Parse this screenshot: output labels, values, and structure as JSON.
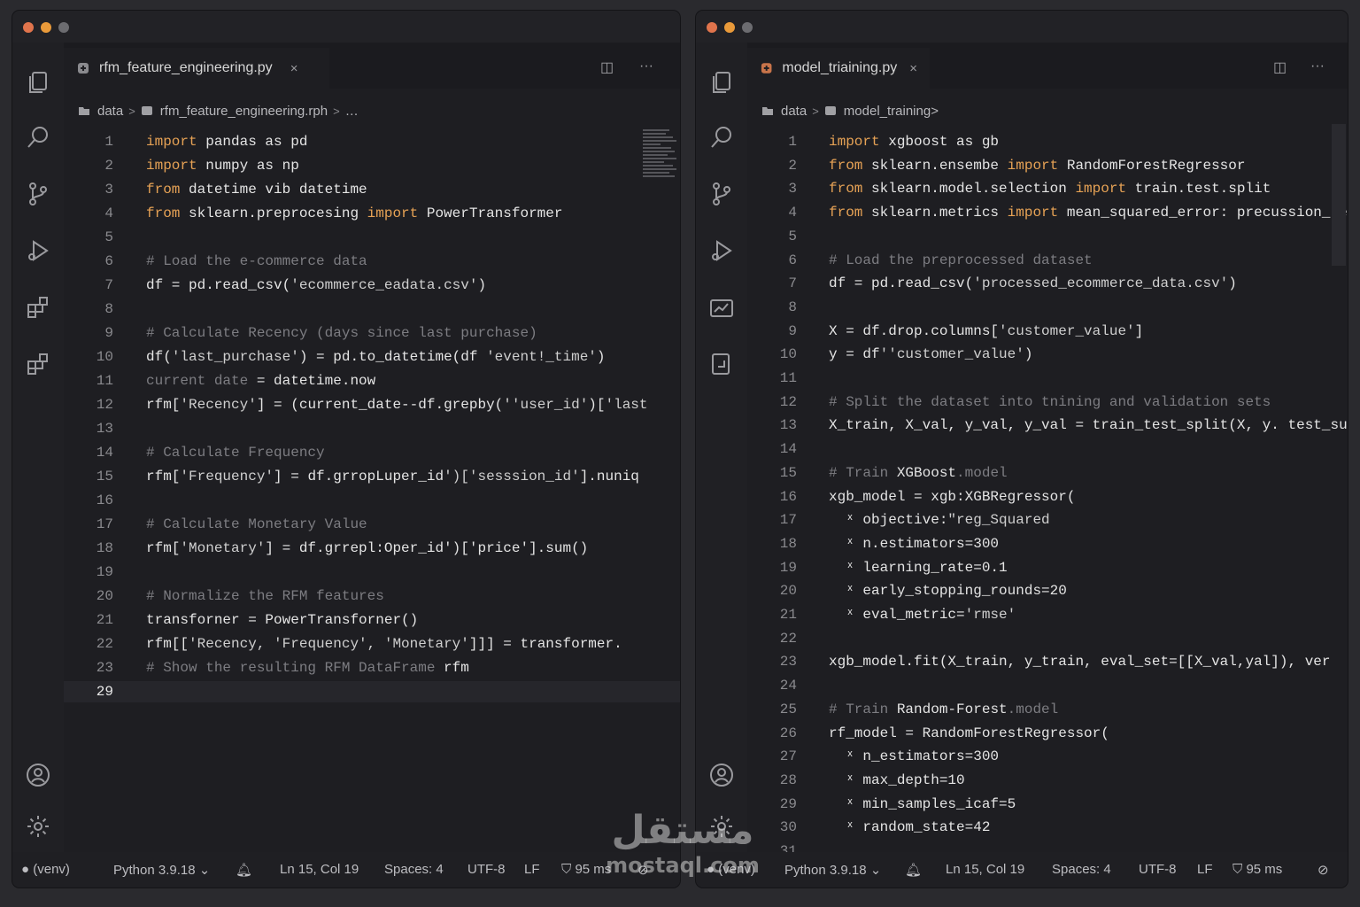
{
  "left": {
    "tab": {
      "label": "rfm_feature_engineering.py",
      "close": "×"
    },
    "toolbar": {
      "split": "◫",
      "more": "···"
    },
    "breadcrumb": {
      "folder": "data",
      "file": "rfm_feature_engineering.rph",
      "tail": "…"
    },
    "lines": [
      {
        "n": "1",
        "segs": [
          [
            "kw",
            "import"
          ],
          [
            "t",
            " pandas as pd"
          ]
        ]
      },
      {
        "n": "2",
        "segs": [
          [
            "kw",
            "import"
          ],
          [
            "t",
            " numpy as np"
          ]
        ]
      },
      {
        "n": "3",
        "segs": [
          [
            "kw",
            "from"
          ],
          [
            "t",
            " datetime vib datetime"
          ]
        ]
      },
      {
        "n": "4",
        "segs": [
          [
            "kw",
            "from"
          ],
          [
            "t",
            " sklearn.preprocesing "
          ],
          [
            "kw",
            "import"
          ],
          [
            "t",
            " PowerTransformer"
          ]
        ]
      },
      {
        "n": "5",
        "segs": []
      },
      {
        "n": "6",
        "segs": [
          [
            "com",
            "# Load the e-commerce data"
          ]
        ]
      },
      {
        "n": "7",
        "segs": [
          [
            "t",
            "df = pd.read_csv("
          ],
          [
            "str",
            "'ecommerce_eadata.csv'"
          ],
          [
            "t",
            ")"
          ]
        ]
      },
      {
        "n": "8",
        "segs": []
      },
      {
        "n": "9",
        "segs": [
          [
            "com",
            "# Calculate Recency (days since last purchase)"
          ]
        ]
      },
      {
        "n": "10",
        "segs": [
          [
            "t",
            "df("
          ],
          [
            "str",
            "'last_purchase'"
          ],
          [
            "t",
            ") = pd.to_datetime(df "
          ],
          [
            "str",
            "'event!_time'"
          ],
          [
            "t",
            ")"
          ]
        ]
      },
      {
        "n": "11",
        "segs": [
          [
            "com",
            "current date"
          ],
          [
            "t",
            " = datetime.now"
          ]
        ]
      },
      {
        "n": "12",
        "segs": [
          [
            "t",
            "rfm["
          ],
          [
            "str",
            "'Recency'"
          ],
          [
            "t",
            "] = (current_date--df.grepby("
          ],
          [
            "str",
            "''user_id'"
          ],
          [
            "t",
            ")["
          ],
          [
            "str",
            "'last"
          ]
        ]
      },
      {
        "n": "13",
        "segs": []
      },
      {
        "n": "14",
        "segs": [
          [
            "com",
            "# Calculate Frequency"
          ]
        ]
      },
      {
        "n": "15",
        "segs": [
          [
            "t",
            "rfm["
          ],
          [
            "str",
            "'Frequency'"
          ],
          [
            "t",
            "] = df.grropLuper_id"
          ],
          [
            "str",
            "')['sesssion_id'"
          ],
          [
            "t",
            "].nuniq"
          ]
        ]
      },
      {
        "n": "16",
        "segs": []
      },
      {
        "n": "17",
        "segs": [
          [
            "com",
            "# Calculate Monetary Value"
          ]
        ]
      },
      {
        "n": "18",
        "segs": [
          [
            "t",
            "rfm["
          ],
          [
            "str",
            "'Monetary'"
          ],
          [
            "t",
            "] = df.grrepl:Oper_id')['price'].sum()"
          ]
        ]
      },
      {
        "n": "19",
        "segs": []
      },
      {
        "n": "20",
        "segs": [
          [
            "com",
            "# Normalize the RFM features"
          ]
        ]
      },
      {
        "n": "21",
        "segs": [
          [
            "t",
            "transforner = PowerTransforner()"
          ]
        ]
      },
      {
        "n": "22",
        "segs": [
          [
            "t",
            "rfm[["
          ],
          [
            "str",
            "'Recency, 'Frequency', 'Monetary'"
          ],
          [
            "t",
            "]]] = transformer."
          ]
        ]
      },
      {
        "n": "23",
        "segs": [
          [
            "com",
            "# Show the resulting RFM DataFrame"
          ],
          [
            "t",
            " rfm"
          ]
        ]
      },
      {
        "n": "29",
        "segs": []
      }
    ],
    "status": {
      "env": "(venv)",
      "python": "Python 3.9.18",
      "position": "Ln 15, Col 19",
      "spaces": "Spaces: 4",
      "encoding": "UTF-8",
      "eol": "LF",
      "timing": "95 ms"
    }
  },
  "right": {
    "tab": {
      "label": "model_triaining.py",
      "close": "×"
    },
    "toolbar": {
      "split": "◫",
      "more": "···"
    },
    "breadcrumb": {
      "folder": "data",
      "file": "model_training",
      "tail": ">"
    },
    "lines": [
      {
        "n": "1",
        "segs": [
          [
            "kw",
            "import"
          ],
          [
            "t",
            " xgboost as gb"
          ]
        ]
      },
      {
        "n": "2",
        "segs": [
          [
            "kw",
            "from"
          ],
          [
            "t",
            " sklearn.ensembe "
          ],
          [
            "kw",
            "import"
          ],
          [
            "t",
            " RandomForestRegressor"
          ]
        ]
      },
      {
        "n": "3",
        "segs": [
          [
            "kw",
            "from"
          ],
          [
            "t",
            " sklearn.model.selection "
          ],
          [
            "kw",
            "import"
          ],
          [
            "t",
            " train.test.split"
          ]
        ]
      },
      {
        "n": "4",
        "segs": [
          [
            "kw",
            "from"
          ],
          [
            "t",
            " sklearn.metrics "
          ],
          [
            "kw",
            "import"
          ],
          [
            "t",
            " mean_squared_error: precussion_re"
          ]
        ]
      },
      {
        "n": "5",
        "segs": []
      },
      {
        "n": "6",
        "segs": [
          [
            "com",
            "# Load the preprocessed dataset"
          ]
        ]
      },
      {
        "n": "7",
        "segs": [
          [
            "t",
            "df = pd.read_csv("
          ],
          [
            "str",
            "'processed_ecommerce_data.csv'"
          ],
          [
            "t",
            ")"
          ]
        ]
      },
      {
        "n": "8",
        "segs": []
      },
      {
        "n": "9",
        "segs": [
          [
            "t",
            "X = df.drop.columns["
          ],
          [
            "str",
            "'customer_value'"
          ],
          [
            "t",
            "]"
          ]
        ]
      },
      {
        "n": "10",
        "segs": [
          [
            "t",
            "y = df"
          ],
          [
            "str",
            "''customer_value'"
          ],
          [
            "t",
            ")"
          ]
        ]
      },
      {
        "n": "11",
        "segs": []
      },
      {
        "n": "12",
        "segs": [
          [
            "com",
            "# Split the dataset into tnining and validation sets"
          ]
        ]
      },
      {
        "n": "13",
        "segs": [
          [
            "t",
            "X_train, X_val, y_val, y_val = train_test_split(X, y. test_suze-"
          ]
        ]
      },
      {
        "n": "14",
        "segs": []
      },
      {
        "n": "15",
        "segs": [
          [
            "com",
            "# Train"
          ],
          [
            "t",
            " XGBoost"
          ],
          [
            "com",
            ".model"
          ]
        ]
      },
      {
        "n": "16",
        "segs": [
          [
            "t",
            "xgb_model = xgb:XGBRegressor("
          ]
        ]
      },
      {
        "n": "17",
        "segs": [
          [
            "t",
            "  ˣ objective:"
          ],
          [
            "str",
            "\"reg_Squared"
          ]
        ]
      },
      {
        "n": "18",
        "segs": [
          [
            "t",
            "  ˣ n.estimators=300"
          ]
        ]
      },
      {
        "n": "19",
        "segs": [
          [
            "t",
            "  ˣ learning_rate=0.1"
          ]
        ]
      },
      {
        "n": "20",
        "segs": [
          [
            "t",
            "  ˣ early_stopping_rounds=20"
          ]
        ]
      },
      {
        "n": "21",
        "segs": [
          [
            "t",
            "  ˣ eval_metric="
          ],
          [
            "str",
            "'rmse'"
          ]
        ]
      },
      {
        "n": "22",
        "segs": []
      },
      {
        "n": "23",
        "segs": [
          [
            "t",
            "xgb_model.fit(X_train, y_train, eval_set=[[X_val,yal]), ver"
          ]
        ]
      },
      {
        "n": "24",
        "segs": []
      },
      {
        "n": "25",
        "segs": [
          [
            "com",
            "# Train"
          ],
          [
            "t",
            " Random-Forest"
          ],
          [
            "com",
            ".model"
          ]
        ]
      },
      {
        "n": "26",
        "segs": [
          [
            "t",
            "rf_model = RandomForestRegressor("
          ]
        ]
      },
      {
        "n": "27",
        "segs": [
          [
            "t",
            "  ˣ n_estimators=300"
          ]
        ]
      },
      {
        "n": "28",
        "segs": [
          [
            "t",
            "  ˣ max_depth=10"
          ]
        ]
      },
      {
        "n": "29",
        "segs": [
          [
            "t",
            "  ˣ min_samples_icaf=5"
          ]
        ]
      },
      {
        "n": "30",
        "segs": [
          [
            "t",
            "  ˣ random_state=42"
          ]
        ]
      },
      {
        "n": "31",
        "segs": []
      }
    ],
    "status": {
      "env": "(venv)",
      "python": "Python 3.9.18",
      "position": "Ln 15, Col 19",
      "spaces": "Spaces: 4",
      "encoding": "UTF-8",
      "eol": "LF",
      "timing": "95 ms"
    }
  },
  "watermark": {
    "arabic": "مستقل",
    "latin": "mostaql.com"
  },
  "colors": {
    "accent": "#e6a255",
    "comment": "#7d7d82",
    "text": "#e4e4e4"
  }
}
